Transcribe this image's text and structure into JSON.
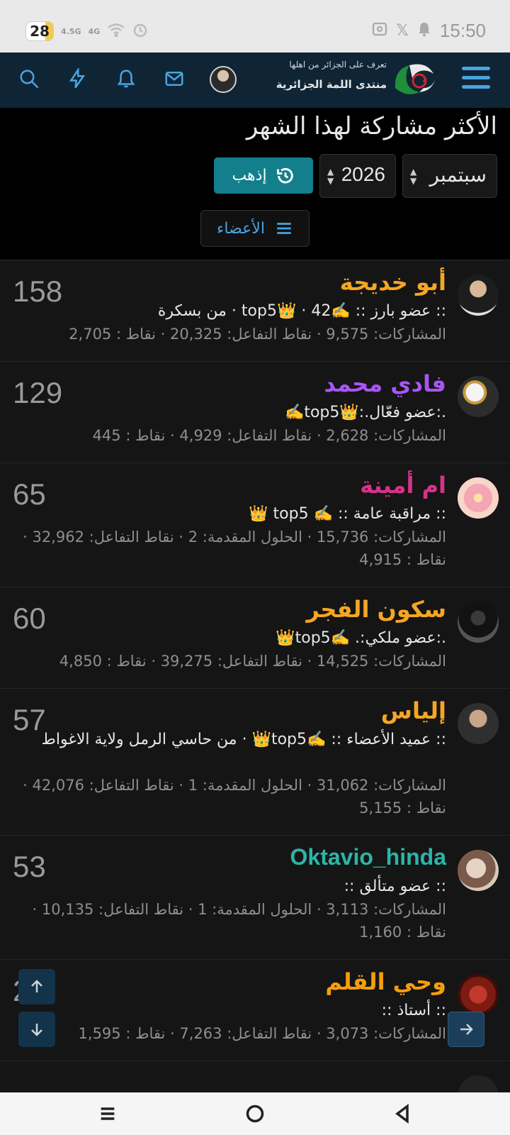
{
  "status_bar": {
    "battery": "28",
    "battery_level": 0.28,
    "signal_1": "4.5G",
    "signal_2": "4G",
    "time": "15:50"
  },
  "nav": {
    "icons": [
      "search-icon",
      "bolt-icon",
      "bell-icon",
      "mail-icon"
    ],
    "logo_tagline": "تعرف على الجزائر من اهلها",
    "logo_name": "منتدى اللمة الجزائرية"
  },
  "page": {
    "title": "الأكثر مشاركة لهذا الشهر",
    "month": "سبتمبر",
    "year": "2026",
    "go_label": "إذهب",
    "members_label": "الأعضاء"
  },
  "members": [
    {
      "name": "أبو خديجة",
      "color": "#f5a623",
      "title": ":: عضو بارز :: ✍️top5👑 · 42 · من بسكرة",
      "stats": "المشاركات: 9,575 · نقاط التفاعل: 20,325 · نقاط : 2,705",
      "count": "158"
    },
    {
      "name": "فادي محمد",
      "color": "#a855f7",
      "title": ".:عضو فعّال.:👑top5✍️",
      "stats": "المشاركات: 2,628 · نقاط التفاعل: 4,929 · نقاط : 445",
      "count": "129"
    },
    {
      "name": "ام أمينة",
      "color": "#d6338a",
      "title": ":: مراقبة عامة :: ✍️ top5 👑",
      "stats": "المشاركات: 15,736 · الحلول المقدمة: 2 · نقاط التفاعل: 32,962 · نقاط : 4,915",
      "count": "65"
    },
    {
      "name": "سكون الفجر",
      "color": "#f5a623",
      "title": ".:عضو ملكي:. ✍️top5👑",
      "stats": "المشاركات: 14,525 · نقاط التفاعل: 39,275 · نقاط : 4,850",
      "count": "60"
    },
    {
      "name": "إلياس",
      "color": "#f5a623",
      "title": ":: عميد الأعضاء :: ✍️top5👑 · من حاسي الرمل ولاية الاغواط",
      "stats": "المشاركات: 31,062 · الحلول المقدمة: 1 · نقاط التفاعل: 42,076 · نقاط : 5,155",
      "count": "57"
    },
    {
      "name": "Oktavio_hinda",
      "color": "#2bb5a8",
      "title": ":: عضو متألق ::",
      "stats": "المشاركات: 3,113 · الحلول المقدمة: 1 · نقاط التفاعل: 10,135 · نقاط : 1,160",
      "count": "53"
    },
    {
      "name": "وحي القلم",
      "color": "#f59e0b",
      "title": ":: أستاذ ::",
      "stats": "المشاركات: 3,073 · نقاط التفاعل: 7,263 · نقاط : 1,595",
      "count": "27"
    }
  ]
}
